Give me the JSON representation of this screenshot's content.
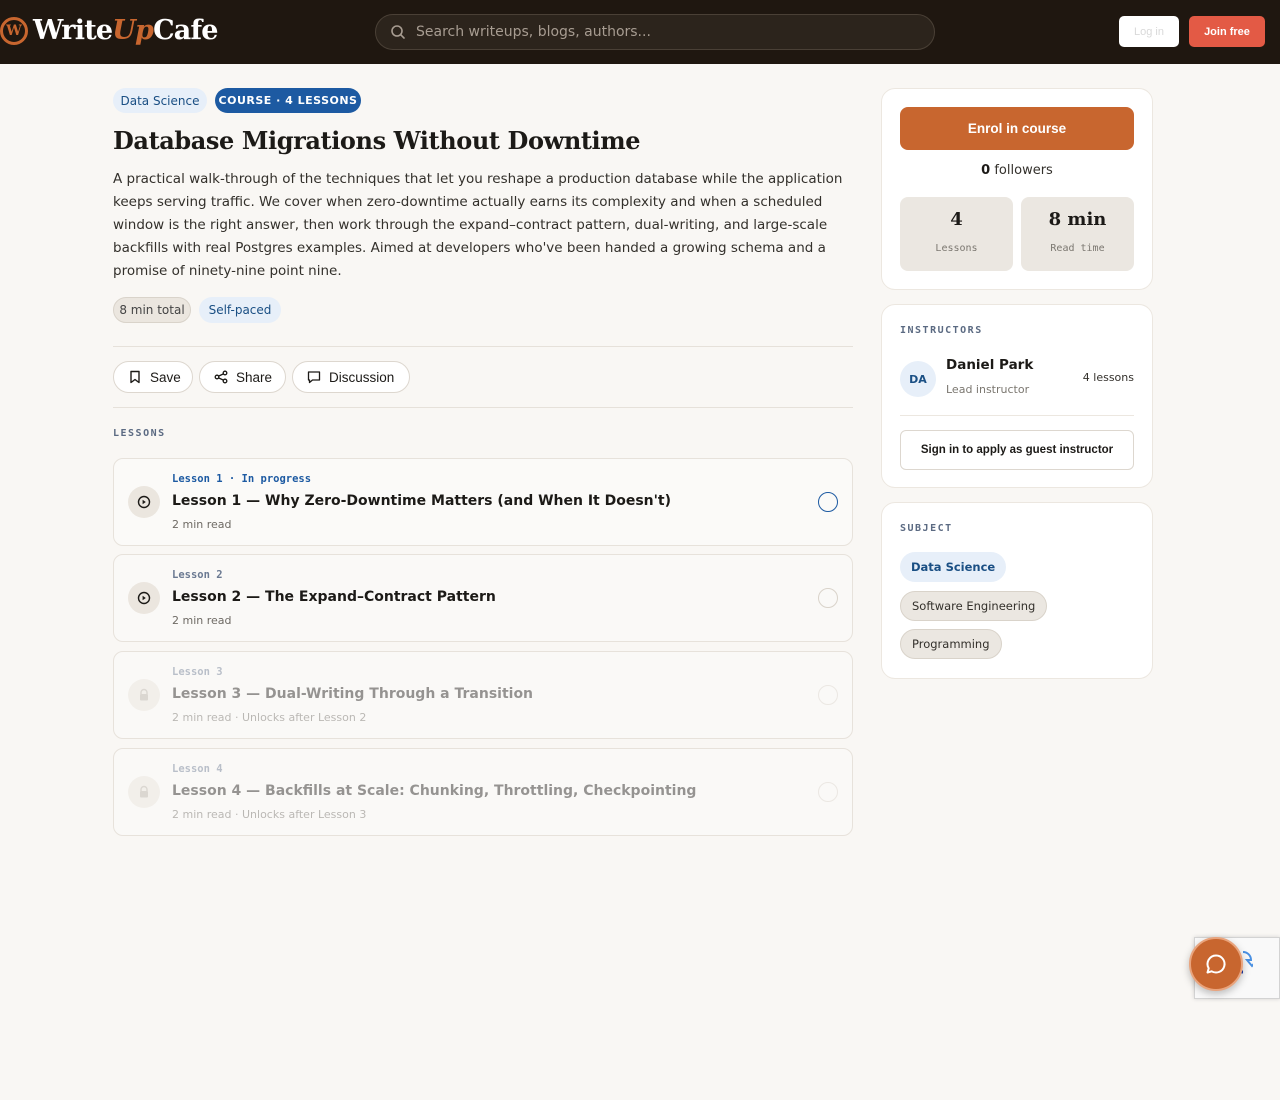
{
  "header": {
    "logo_mark": "W",
    "logo_write": "Write",
    "logo_up": "Up",
    "logo_cafe": "Cafe",
    "search_placeholder": "Search writeups, blogs, authors...",
    "login_label": "Log in",
    "join_label": "Join free"
  },
  "course": {
    "category_tag": "Data Science",
    "type_tag": "COURSE · 4 LESSONS",
    "title": "Database Migrations Without Downtime",
    "description": "A practical walk-through of the techniques that let you reshape a production database while the application keeps serving traffic. We cover when zero-downtime actually earns its complexity and when a scheduled window is the right answer, then work through the expand–contract pattern, dual-writing, and large-scale backfills with real Postgres examples. Aimed at developers who've been handed a growing schema and a promise of ninety-nine point nine.",
    "duration_tag": "8 min total",
    "pace_tag": "Self-paced"
  },
  "actions": {
    "save_label": "Save",
    "share_label": "Share",
    "discussion_label": "Discussion"
  },
  "lessons_heading": "LESSONS",
  "lessons": [
    {
      "meta": "Lesson 1 · In progress",
      "title": "Lesson 1 — Why Zero-Downtime Matters (and When It Doesn't)",
      "sub": "2 min read",
      "state": "in-progress"
    },
    {
      "meta": "Lesson 2",
      "title": "Lesson 2 — The Expand–Contract Pattern",
      "sub": "2 min read",
      "state": "available"
    },
    {
      "meta": "Lesson 3",
      "title": "Lesson 3 — Dual-Writing Through a Transition",
      "sub": "2 min read · Unlocks after Lesson 2",
      "state": "locked"
    },
    {
      "meta": "Lesson 4",
      "title": "Lesson 4 — Backfills at Scale: Chunking, Throttling, Checkpointing",
      "sub": "2 min read · Unlocks after Lesson 3",
      "state": "locked"
    }
  ],
  "sidebar": {
    "enrol_label": "Enrol in course",
    "followers_count": "0",
    "followers_label": "followers",
    "stats": [
      {
        "value": "4",
        "label": "Lessons"
      },
      {
        "value": "8 min",
        "label": "Read time"
      }
    ],
    "instructors_heading": "INSTRUCTORS",
    "instructor": {
      "initials": "DA",
      "name": "Daniel Park",
      "role": "Lead instructor",
      "lessons": "4 lessons"
    },
    "guest_label": "Sign in to apply as guest instructor",
    "subject_heading": "SUBJECT",
    "subjects": [
      "Data Science",
      "Software Engineering",
      "Programming"
    ]
  },
  "colors": {
    "accent": "#c8662f",
    "brand_blue": "#1d5aa2",
    "join": "#e35a45",
    "header_bg": "#1f1710"
  }
}
